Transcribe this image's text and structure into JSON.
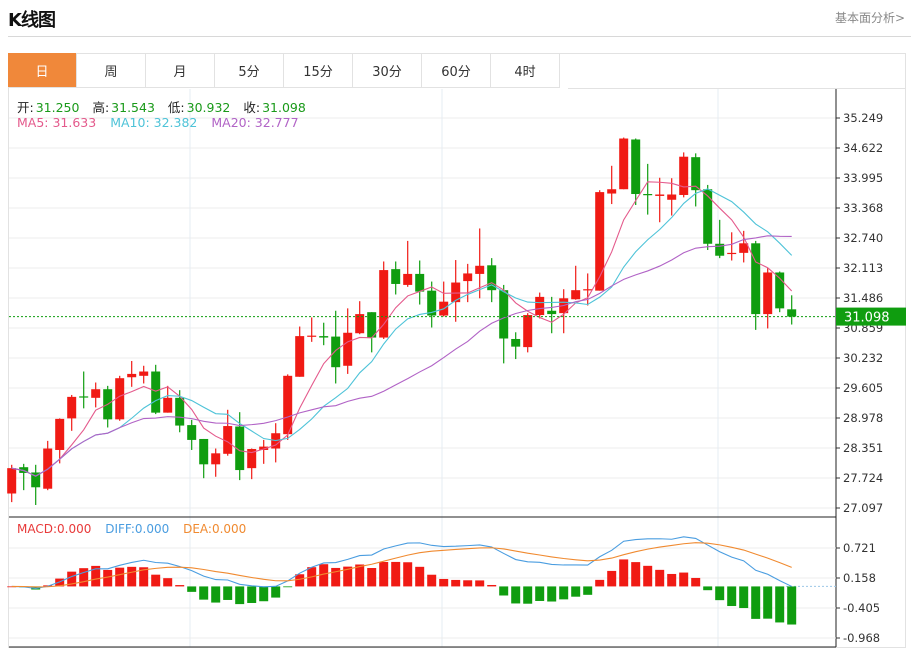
{
  "header": {
    "title": "K线图",
    "link": "基本面分析>"
  },
  "tabs": [
    {
      "label": "日",
      "active": true
    },
    {
      "label": "周"
    },
    {
      "label": "月"
    },
    {
      "label": "5分"
    },
    {
      "label": "15分"
    },
    {
      "label": "30分"
    },
    {
      "label": "60分"
    },
    {
      "label": "4时"
    }
  ],
  "ohlc_legend": {
    "open_label": "开:",
    "open": "31.250",
    "high_label": "高:",
    "high": "31.543",
    "low_label": "低:",
    "low": "30.932",
    "close_label": "收:",
    "close": "31.098"
  },
  "ma_legend": {
    "ma5": "MA5: 31.633",
    "ma10": "MA10: 32.382",
    "ma20": "MA20: 32.777"
  },
  "macd_legend": {
    "macd": "MACD:0.000",
    "diff": "DIFF:0.000",
    "dea": "DEA:0.000"
  },
  "colors": {
    "up": "#f01a14",
    "down": "#0f9d0f",
    "ma5": "#e45a8c",
    "ma10": "#4ec3d8",
    "ma20": "#b163c6",
    "diff": "#4a9de0",
    "dea": "#f08a30",
    "active_tab": "#f0883a",
    "last_price_bg": "#0f9d0f"
  },
  "chart_data": {
    "type": "candlestick",
    "price_ticks": [
      "35.249",
      "34.622",
      "33.995",
      "33.368",
      "32.740",
      "32.113",
      "31.486",
      "30.859",
      "30.232",
      "29.605",
      "28.978",
      "28.351",
      "27.724",
      "27.097"
    ],
    "ylim": [
      27.097,
      35.249
    ],
    "last_price": "31.098",
    "grid": true,
    "candles_ohlc": [
      [
        27.4,
        28.0,
        27.22,
        27.93
      ],
      [
        27.95,
        28.02,
        27.47,
        27.83
      ],
      [
        27.84,
        28.0,
        27.16,
        27.53
      ],
      [
        27.5,
        28.5,
        27.47,
        28.34
      ],
      [
        28.31,
        28.97,
        28.03,
        28.96
      ],
      [
        28.97,
        29.46,
        28.71,
        29.42
      ],
      [
        29.43,
        29.95,
        29.18,
        29.41
      ],
      [
        29.4,
        29.72,
        29.2,
        29.58
      ],
      [
        29.58,
        29.65,
        28.78,
        28.95
      ],
      [
        28.95,
        29.86,
        28.92,
        29.81
      ],
      [
        29.83,
        30.17,
        29.63,
        29.9
      ],
      [
        29.86,
        30.07,
        29.7,
        29.95
      ],
      [
        29.95,
        30.09,
        29.06,
        29.09
      ],
      [
        29.09,
        29.65,
        29.09,
        29.4
      ],
      [
        29.4,
        29.56,
        28.68,
        28.82
      ],
      [
        28.83,
        28.94,
        28.31,
        28.52
      ],
      [
        28.54,
        28.54,
        27.72,
        28.01
      ],
      [
        28.01,
        28.34,
        27.75,
        28.24
      ],
      [
        28.23,
        29.15,
        28.19,
        28.81
      ],
      [
        28.8,
        29.1,
        27.68,
        27.89
      ],
      [
        27.93,
        28.34,
        27.7,
        28.33
      ],
      [
        28.31,
        28.52,
        28.02,
        28.38
      ],
      [
        28.34,
        28.87,
        28.05,
        28.66
      ],
      [
        28.64,
        29.89,
        28.52,
        29.86
      ],
      [
        29.84,
        30.89,
        29.84,
        30.69
      ],
      [
        30.69,
        31.08,
        30.57,
        30.7
      ],
      [
        30.69,
        30.97,
        30.5,
        30.66
      ],
      [
        30.68,
        31.22,
        29.7,
        30.04
      ],
      [
        30.07,
        31.27,
        29.9,
        30.76
      ],
      [
        30.75,
        31.42,
        30.73,
        31.15
      ],
      [
        31.19,
        31.19,
        30.35,
        30.66
      ],
      [
        30.66,
        32.25,
        30.63,
        32.07
      ],
      [
        32.09,
        32.25,
        31.56,
        31.78
      ],
      [
        31.76,
        32.68,
        31.72,
        31.99
      ],
      [
        31.99,
        32.27,
        31.35,
        31.62
      ],
      [
        31.64,
        31.83,
        30.87,
        31.12
      ],
      [
        31.12,
        31.83,
        31.1,
        31.41
      ],
      [
        31.4,
        32.28,
        30.99,
        31.81
      ],
      [
        31.84,
        32.2,
        31.4,
        32.0
      ],
      [
        31.99,
        32.94,
        31.48,
        32.16
      ],
      [
        32.17,
        32.32,
        31.4,
        31.65
      ],
      [
        31.65,
        31.76,
        30.12,
        30.64
      ],
      [
        30.63,
        30.77,
        30.21,
        30.47
      ],
      [
        30.46,
        31.17,
        30.35,
        31.13
      ],
      [
        31.13,
        31.6,
        31.06,
        31.51
      ],
      [
        31.22,
        31.51,
        30.75,
        31.15
      ],
      [
        31.17,
        31.67,
        30.75,
        31.48
      ],
      [
        31.46,
        32.16,
        31.45,
        31.65
      ],
      [
        31.65,
        32.0,
        31.33,
        31.67
      ],
      [
        31.64,
        33.74,
        31.64,
        33.7
      ],
      [
        33.67,
        34.25,
        33.45,
        33.76
      ],
      [
        33.76,
        34.84,
        33.76,
        34.82
      ],
      [
        34.8,
        34.82,
        33.43,
        33.66
      ],
      [
        33.66,
        34.29,
        33.23,
        33.64
      ],
      [
        33.62,
        34.0,
        33.07,
        33.65
      ],
      [
        33.54,
        33.99,
        33.21,
        33.65
      ],
      [
        33.64,
        34.53,
        33.59,
        34.44
      ],
      [
        34.43,
        34.51,
        33.4,
        33.74
      ],
      [
        33.76,
        33.85,
        32.49,
        32.62
      ],
      [
        32.62,
        33.12,
        32.32,
        32.37
      ],
      [
        32.41,
        32.86,
        32.27,
        32.43
      ],
      [
        32.43,
        32.89,
        32.23,
        32.63
      ],
      [
        32.63,
        32.68,
        30.82,
        31.15
      ],
      [
        31.15,
        32.11,
        30.85,
        32.02
      ],
      [
        32.02,
        32.04,
        31.19,
        31.27
      ],
      [
        31.25,
        31.543,
        30.932,
        31.098
      ]
    ],
    "moving_averages": [
      5,
      10,
      20
    ],
    "macd": {
      "ticks": [
        "0.721",
        "0.158",
        "-0.405",
        "-0.968"
      ],
      "params": [
        12,
        26,
        9
      ]
    }
  }
}
